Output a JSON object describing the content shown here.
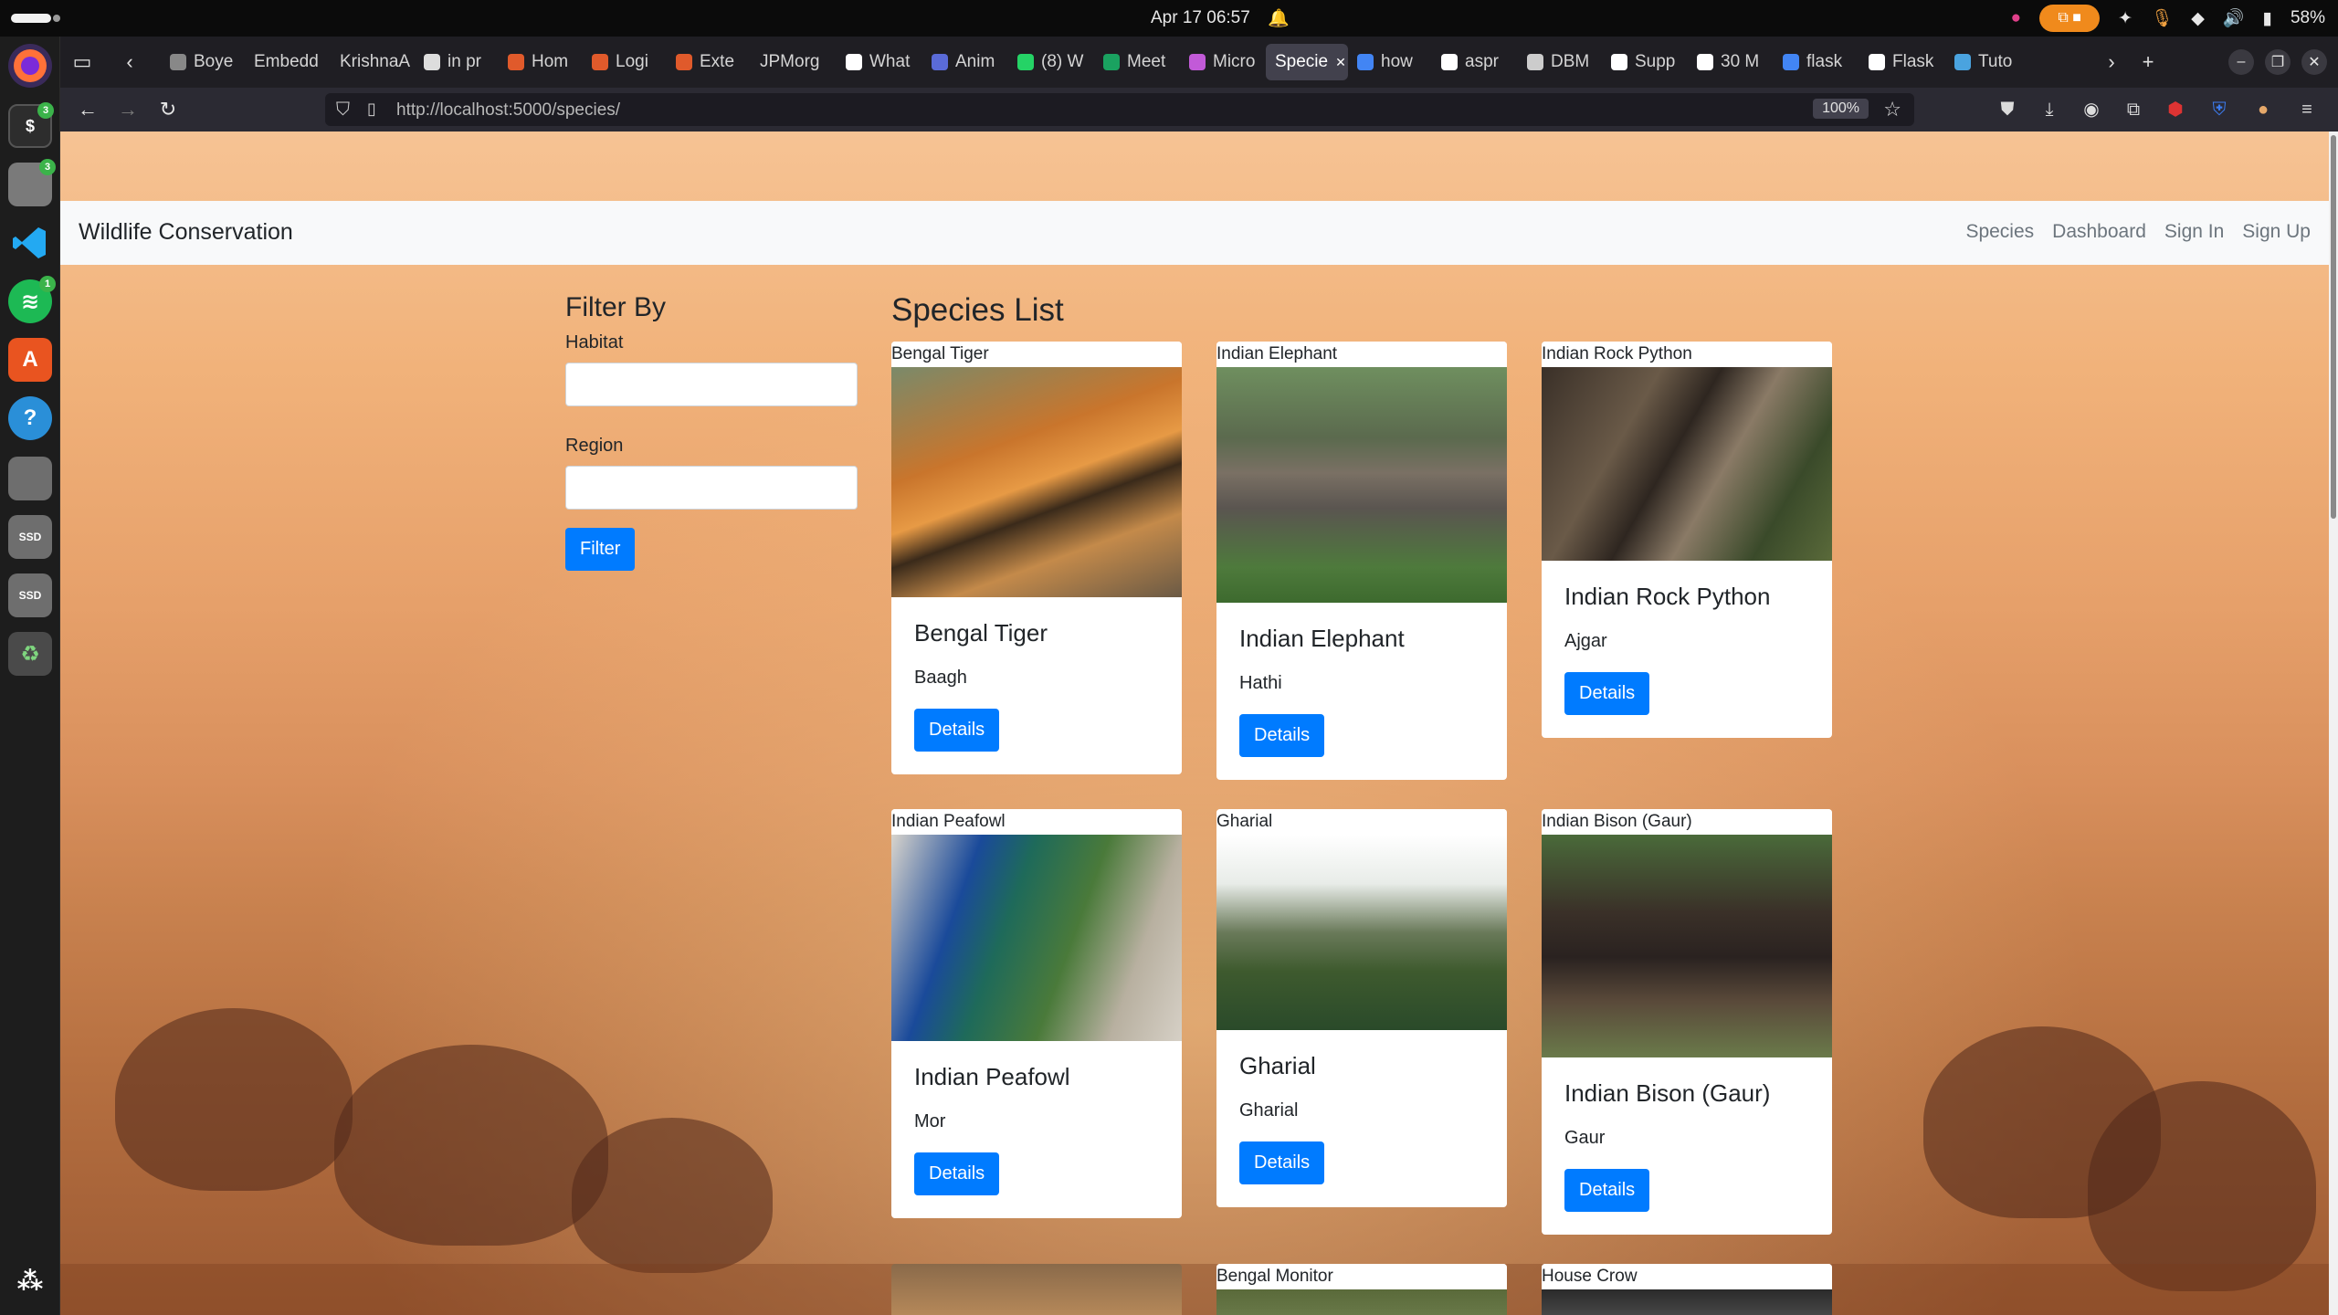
{
  "system": {
    "clock": "Apr 17  06:57",
    "battery": "58%"
  },
  "browser": {
    "tabs": [
      {
        "label": "Boye",
        "color": "#888888"
      },
      {
        "label": "Embedd",
        "color": ""
      },
      {
        "label": "KrishnaA",
        "color": ""
      },
      {
        "label": "in pr",
        "color": "#dddddd"
      },
      {
        "label": "Hom",
        "color": "#e05a2b"
      },
      {
        "label": "Logi",
        "color": "#e05a2b"
      },
      {
        "label": "Exte",
        "color": "#e05a2b"
      },
      {
        "label": "JPMorg",
        "color": ""
      },
      {
        "label": "What",
        "color": "#ffffff"
      },
      {
        "label": "Anim",
        "color": "#5a6bd8"
      },
      {
        "label": "(8) W",
        "color": "#25d366"
      },
      {
        "label": "Meet",
        "color": "#1aa260"
      },
      {
        "label": "Micro",
        "color": "#c25ad8"
      },
      {
        "label": "Specie",
        "color": "",
        "active": true
      },
      {
        "label": "how",
        "color": "#4285f4"
      },
      {
        "label": "aspr",
        "color": "#ffffff"
      },
      {
        "label": "DBM",
        "color": "#cccccc"
      },
      {
        "label": "Supp",
        "color": "#ffffff"
      },
      {
        "label": "30 M",
        "color": "#ffffff"
      },
      {
        "label": "flask",
        "color": "#4285f4"
      },
      {
        "label": "Flask",
        "color": "#ffffff"
      },
      {
        "label": "Tuto",
        "color": "#4aa3df"
      }
    ],
    "url": "http://localhost:5000/species/",
    "zoom": "100%"
  },
  "site": {
    "brand": "Wildlife Conservation",
    "nav": [
      "Species",
      "Dashboard",
      "Sign In",
      "Sign Up"
    ]
  },
  "filter": {
    "title": "Filter By",
    "habitat_label": "Habitat",
    "habitat_value": "",
    "region_label": "Region",
    "region_value": "",
    "button": "Filter"
  },
  "species": {
    "title": "Species List",
    "cards": [
      {
        "name": "Bengal Tiger",
        "local": "Baagh",
        "button": "Details"
      },
      {
        "name": "Indian Elephant",
        "local": "Hathi",
        "button": "Details"
      },
      {
        "name": "Indian Rock Python",
        "local": "Ajgar",
        "button": "Details"
      },
      {
        "name": "Indian Peafowl",
        "local": "Mor",
        "button": "Details"
      },
      {
        "name": "Gharial",
        "local": "Gharial",
        "button": "Details"
      },
      {
        "name": "Indian Bison (Gaur)",
        "local": "Gaur",
        "button": "Details"
      },
      {
        "name": "",
        "local": "",
        "button": ""
      },
      {
        "name": "Bengal Monitor",
        "local": "",
        "button": ""
      },
      {
        "name": "House Crow",
        "local": "",
        "button": ""
      }
    ]
  }
}
